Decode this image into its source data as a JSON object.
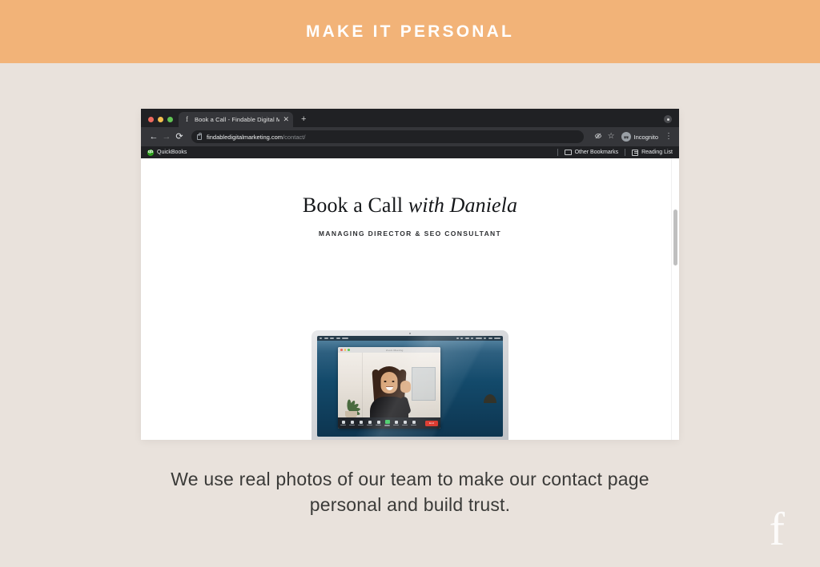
{
  "banner": {
    "title": "MAKE IT PERSONAL",
    "background_color": "#F2B378",
    "text_color": "#FFFFFF"
  },
  "page_background_color": "#E9E2DC",
  "browser": {
    "window_controls": {
      "close_label": "close",
      "minimize_label": "minimize",
      "maximize_label": "maximize"
    },
    "tab": {
      "title": "Book a Call - Findable Digital M",
      "favicon": "f",
      "close_icon": "✕"
    },
    "new_tab_icon": "+",
    "tabstrip_right_icon": "profile-dot",
    "toolbar": {
      "back_icon": "←",
      "forward_icon": "→",
      "reload_icon": "⟳",
      "lock_icon": "lock",
      "url_host": "findabledigitalmarketing.com",
      "url_path": "/contact/",
      "eye_slash_icon": "ø",
      "star_icon": "☆",
      "incognito_label": "Incognito",
      "incognito_icon": "●",
      "menu_icon": "⋮"
    },
    "bookmarks": {
      "quickbooks_label": "QuickBooks",
      "quickbooks_icon": "qb",
      "other_bookmarks_label": "Other Bookmarks",
      "reading_list_label": "Reading List"
    }
  },
  "webpage": {
    "heading_regular": "Book a Call ",
    "heading_italic": "with Daniela",
    "subheading": "MANAGING DIRECTOR & SEO CONSULTANT",
    "laptop_image": {
      "alt": "Zoom video call with Daniela waving",
      "zoom_window_title": "Zoom Meeting",
      "end_button_label": "End"
    }
  },
  "caption": {
    "line1": "We use real photos of our team to make our contact page",
    "line2": "personal and build trust."
  },
  "watermark": {
    "letter": "f"
  }
}
